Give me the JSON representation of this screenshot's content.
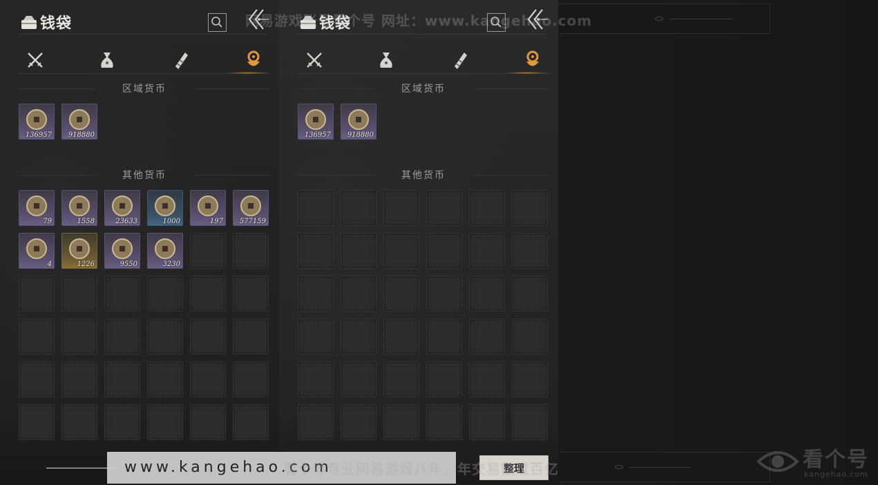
{
  "panels": [
    {
      "title": "钱袋",
      "regional_label": "区域货币",
      "other_label": "其他货币",
      "regional_items": [
        {
          "icon": "bronze-token-icon",
          "count": "136957",
          "rarity": "purple"
        },
        {
          "icon": "ancient-coin-icon",
          "count": "918880",
          "rarity": "purple"
        }
      ],
      "other_items": [
        {
          "icon": "wooden-tablet-icon",
          "count": "79",
          "rarity": "purple"
        },
        {
          "icon": "jade-pile-icon",
          "count": "1558",
          "rarity": "purple"
        },
        {
          "icon": "silver-ingot-icon",
          "count": "23633",
          "rarity": "purple"
        },
        {
          "icon": "copper-cash-icon",
          "count": "1000",
          "rarity": "blue"
        },
        {
          "icon": "red-charm-icon",
          "count": "197",
          "rarity": "purple"
        },
        {
          "icon": "coin-string-icon",
          "count": "577159",
          "rarity": "purple"
        },
        {
          "icon": "bamboo-slips-icon",
          "count": "4",
          "rarity": "purple"
        },
        {
          "icon": "jade-bi-icon",
          "count": "1226",
          "rarity": "gold"
        },
        {
          "icon": "key-token-icon",
          "count": "9550",
          "rarity": "purple"
        },
        {
          "icon": "half-coin-icon",
          "count": "3230",
          "rarity": "purple"
        }
      ]
    },
    {
      "title": "钱袋",
      "regional_label": "区域货币",
      "other_label": "其他货币",
      "regional_items": [
        {
          "icon": "bronze-token-icon",
          "count": "136957",
          "rarity": "purple"
        },
        {
          "icon": "ancient-coin-icon",
          "count": "918880",
          "rarity": "purple"
        }
      ],
      "other_items": []
    }
  ],
  "tabs": [
    "weapons-tab",
    "pouch-tab",
    "scroll-tab",
    "currency-tab"
  ],
  "active_tab": "currency-tab",
  "organize_button": "整理",
  "url_banner": "www.kangehao.com",
  "watermark_top": "网易游戏账号看个号  网址：www.kangehao.com",
  "watermark_bottom": "看个号专业网易游戏八年，年交易额过百亿",
  "logo": {
    "name": "看个号",
    "sub": "kangehao.com"
  },
  "colors": {
    "accent": "#e39a3f",
    "purple": "#5a4f6c",
    "blue": "#3b5166",
    "gold": "#6b5a33"
  }
}
